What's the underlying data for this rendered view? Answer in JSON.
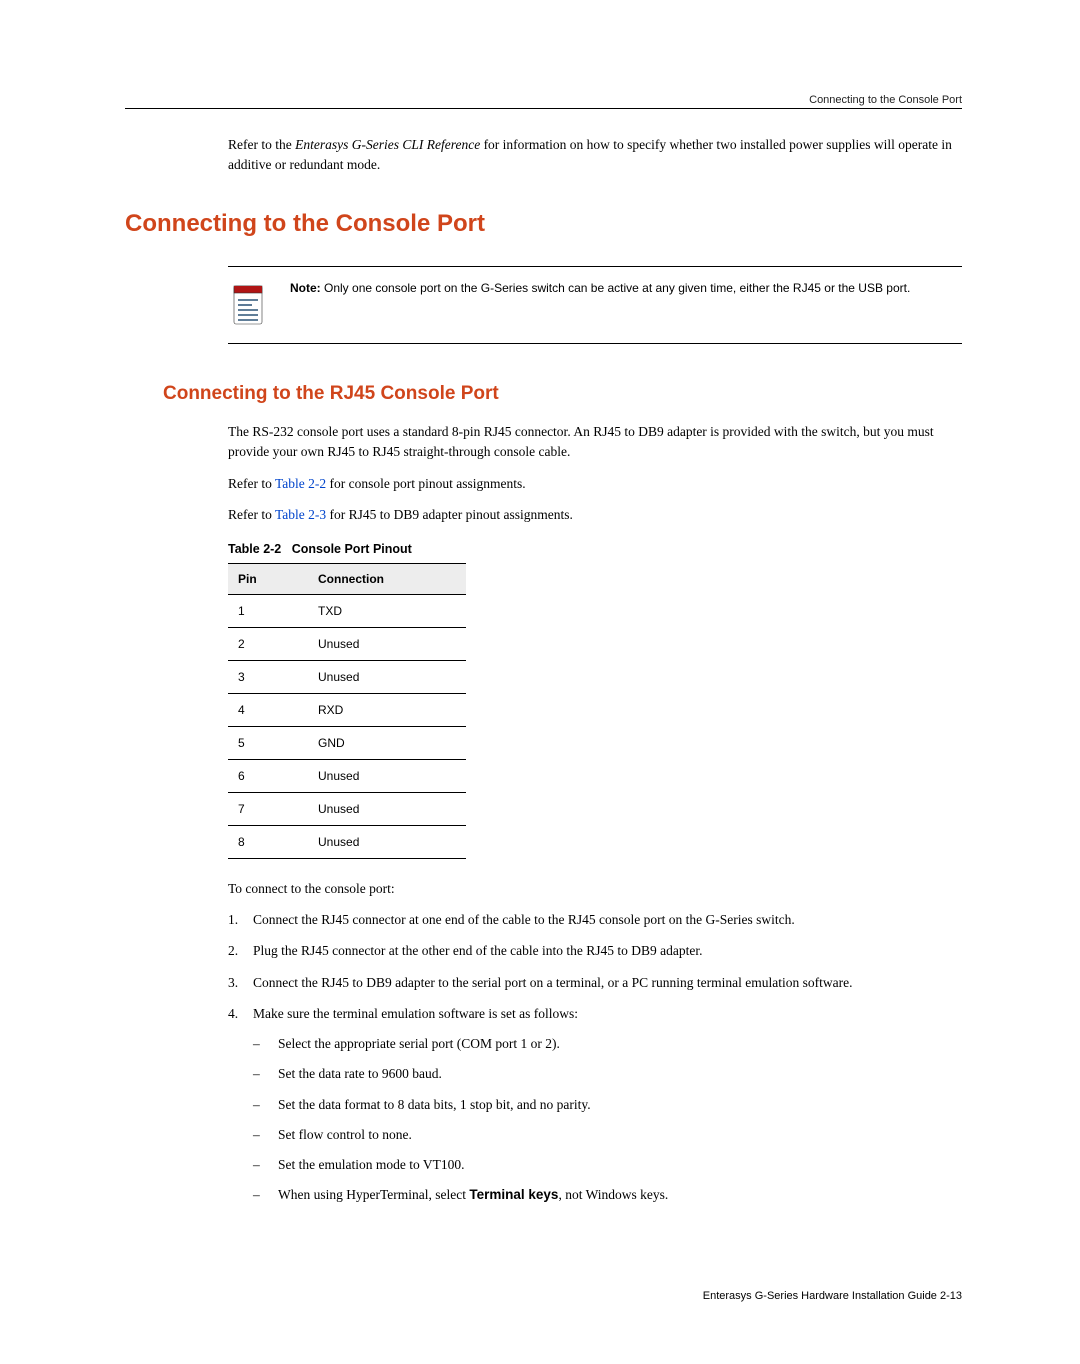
{
  "header_right": "Connecting to the Console Port",
  "intro": {
    "prefix": "Refer to the ",
    "italic": "Enterasys G-Series CLI Reference",
    "suffix": "  for information on how to specify whether two installed power supplies will operate in additive or redundant mode."
  },
  "h1": "Connecting to the Console Port",
  "note": {
    "label": "Note:",
    "text": " Only one console port on the G-Series switch can be active at any given time, either the RJ45 or the USB port."
  },
  "h2": "Connecting to the RJ45 Console Port",
  "p1": "The RS-232 console port uses a standard 8-pin RJ45 connector. An RJ45 to DB9 adapter is provided with the switch, but you must provide your own RJ45 to RJ45 straight-through console cable.",
  "p2": {
    "prefix": "Refer to ",
    "link": "Table 2-2",
    "suffix": " for console port pinout assignments."
  },
  "p3": {
    "prefix": "Refer to ",
    "link": "Table 2-3",
    "suffix": " for RJ45 to DB9 adapter pinout assignments."
  },
  "table": {
    "caption_prefix": "Table 2-2",
    "caption_title": "Console Port Pinout",
    "headers": {
      "pin": "Pin",
      "connection": "Connection"
    },
    "rows": [
      {
        "pin": "1",
        "connection": "TXD"
      },
      {
        "pin": "2",
        "connection": "Unused"
      },
      {
        "pin": "3",
        "connection": "Unused"
      },
      {
        "pin": "4",
        "connection": "RXD"
      },
      {
        "pin": "5",
        "connection": "GND"
      },
      {
        "pin": "6",
        "connection": "Unused"
      },
      {
        "pin": "7",
        "connection": "Unused"
      },
      {
        "pin": "8",
        "connection": "Unused"
      }
    ]
  },
  "p4": "To connect to the console port:",
  "steps": {
    "s1": "Connect the RJ45 connector at one end of the cable to the RJ45 console port on the G-Series switch.",
    "s2": "Plug the RJ45 connector at the other end of the cable into the RJ45 to DB9 adapter.",
    "s3": "Connect the RJ45 to DB9 adapter to the serial port on a terminal, or a PC running terminal emulation software.",
    "s4": "Make sure the terminal emulation software is set as follows:",
    "sub": {
      "a": "Select the appropriate serial port (COM port 1 or 2).",
      "b": "Set the data rate to 9600 baud.",
      "c": "Set the data format to 8 data bits, 1 stop bit, and no parity.",
      "d": "Set flow control to none.",
      "e": "Set the emulation mode to VT100.",
      "f_prefix": "When using HyperTerminal, select ",
      "f_bold": "Terminal keys",
      "f_suffix": ", not Windows keys."
    }
  },
  "footer": "Enterasys G-Series Hardware Installation Guide 2-13"
}
